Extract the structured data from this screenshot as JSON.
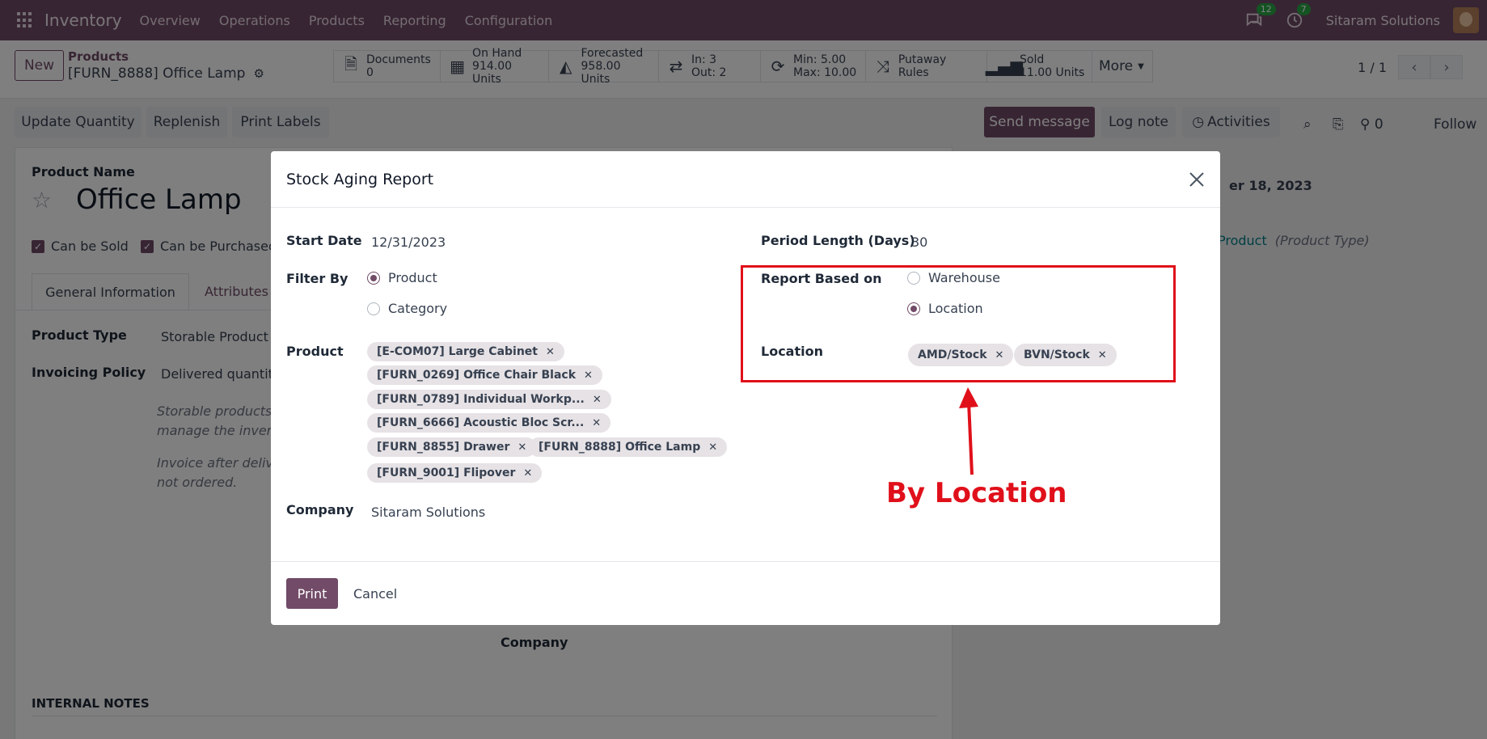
{
  "navbar": {
    "app_title": "Inventory",
    "menu": [
      "Overview",
      "Operations",
      "Products",
      "Reporting",
      "Configuration"
    ],
    "messages_count": "12",
    "activities_count": "7",
    "company": "Sitaram Solutions"
  },
  "control": {
    "new_label": "New",
    "breadcrumb_parent": "Products",
    "breadcrumb_current": "[FURN_8888] Office Lamp",
    "smart_buttons": [
      {
        "title": "Documents",
        "value": "0"
      },
      {
        "title": "On Hand",
        "value": "914.00 Units"
      },
      {
        "title": "Forecasted",
        "value": "958.00 Units"
      },
      {
        "title": "In: 3",
        "value": "Out: 2"
      },
      {
        "title": "Min: 5.00",
        "value": "Max: 10.00"
      },
      {
        "title": "Putaway Rules",
        "value": ""
      },
      {
        "title": "Sold",
        "value": "11.00 Units"
      },
      {
        "title": "More",
        "value": ""
      }
    ],
    "pager": "1 / 1"
  },
  "actions": {
    "update_quantity": "Update Quantity",
    "replenish": "Replenish",
    "print_labels": "Print Labels",
    "send_message": "Send message",
    "log_note": "Log note",
    "activities": "Activities",
    "followers_count": "0",
    "follow": "Follow"
  },
  "form": {
    "product_name_label": "Product Name",
    "product_name": "Office Lamp",
    "can_be_sold": "Can be Sold",
    "can_be_purchased": "Can be Purchased",
    "tab_general": "General Information",
    "tab_attributes": "Attributes",
    "product_type_label": "Product Type",
    "product_type_value": "Storable Product",
    "invoicing_policy_label": "Invoicing Policy",
    "invoicing_policy_value": "Delivered quantiti",
    "help_1a": "Storable products a",
    "help_1b": "manage the invento",
    "help_2a": "Invoice after delive",
    "help_2b": "not ordered.",
    "company_label": "Company",
    "internal_notes": "INTERNAL NOTES"
  },
  "chatter": {
    "date_fragment": "er 18, 2023",
    "product_link": "Product",
    "product_type_note": "(Product Type)"
  },
  "modal": {
    "title": "Stock Aging Report",
    "start_date_label": "Start Date",
    "start_date_value": "12/31/2023",
    "period_length_label": "Period Length (Days)",
    "period_length_value": "30",
    "filter_by_label": "Filter By",
    "filter_options": [
      "Product",
      "Category"
    ],
    "filter_selected": "Product",
    "report_based_label": "Report Based on",
    "report_based_options": [
      "Warehouse",
      "Location"
    ],
    "report_based_selected": "Location",
    "product_label": "Product",
    "product_tags": [
      "[E-COM07] Large Cabinet",
      "[FURN_0269] Office Chair Black",
      "[FURN_0789] Individual Workp...",
      "[FURN_6666] Acoustic Bloc Scr...",
      "[FURN_8855] Drawer",
      "[FURN_8888] Office Lamp",
      "[FURN_9001] Flipover"
    ],
    "location_label": "Location",
    "location_tags": [
      "AMD/Stock",
      "BVN/Stock"
    ],
    "company_label": "Company",
    "company_value": "Sitaram Solutions",
    "print_label": "Print",
    "cancel_label": "Cancel"
  },
  "annotation": {
    "text": "By Location",
    "color": "#e0101a"
  },
  "colors": {
    "brand": "#714b67",
    "badge": "#28a745"
  }
}
